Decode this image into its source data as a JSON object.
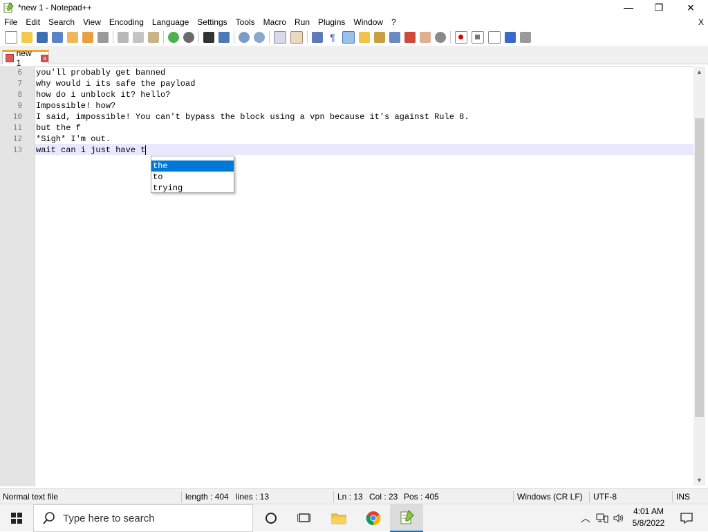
{
  "window": {
    "title": "*new 1 - Notepad++",
    "controls": {
      "minimize": "—",
      "maximize": "❐",
      "close": "✕"
    }
  },
  "menu": {
    "items": [
      "File",
      "Edit",
      "Search",
      "View",
      "Encoding",
      "Language",
      "Settings",
      "Tools",
      "Macro",
      "Run",
      "Plugins",
      "Window",
      "?"
    ],
    "close_doc": "X"
  },
  "toolbar": {
    "icons": [
      "new-file-icon",
      "open-file-icon",
      "save-icon",
      "save-all-icon",
      "close-icon",
      "close-all-icon",
      "print-icon",
      "cut-icon",
      "copy-icon",
      "paste-icon",
      "undo-icon",
      "redo-icon",
      "find-icon",
      "replace-icon",
      "zoom-in-icon",
      "zoom-out-icon",
      "sync-vertical-icon",
      "sync-horizontal-icon",
      "word-wrap-icon",
      "show-all-chars-icon",
      "indent-guide-icon",
      "udl-icon",
      "doc-map-icon",
      "function-list-icon",
      "folder-workspace-icon",
      "monitoring-icon",
      "record-macro-icon",
      "stop-macro-icon",
      "play-macro-icon",
      "run-macro-multiple-icon",
      "save-macro-icon"
    ]
  },
  "tabs": [
    {
      "label": "new 1",
      "close": "x"
    }
  ],
  "editor": {
    "lines": [
      {
        "num": "6",
        "text": "you'll probably get banned"
      },
      {
        "num": "7",
        "text": "why would i its safe the payload"
      },
      {
        "num": "8",
        "text": "how do i unblock it? hello?"
      },
      {
        "num": "9",
        "text": "Impossible! how?"
      },
      {
        "num": "10",
        "text": "I said, impossible! You can't bypass the block using a vpn because it's against Rule 8."
      },
      {
        "num": "11",
        "text": "but the f"
      },
      {
        "num": "12",
        "text": "*Sigh* I'm out."
      },
      {
        "num": "13",
        "text": "wait can i just have t"
      }
    ],
    "autocomplete": [
      "the",
      "to",
      "trying"
    ]
  },
  "statusbar": {
    "file_type": "Normal text file",
    "length": "length : 404",
    "lines": "lines : 13",
    "ln": "Ln : 13",
    "col": "Col : 23",
    "pos": "Pos : 405",
    "eol": "Windows (CR LF)",
    "encoding": "UTF-8",
    "mode": "INS"
  },
  "taskbar": {
    "search_placeholder": "Type here to search",
    "time": "4:01 AM",
    "date": "5/8/2022"
  },
  "colors": {
    "accent": "#0078d7",
    "current_line": "#e8e8ff",
    "tab_highlight": "#f5a623"
  }
}
